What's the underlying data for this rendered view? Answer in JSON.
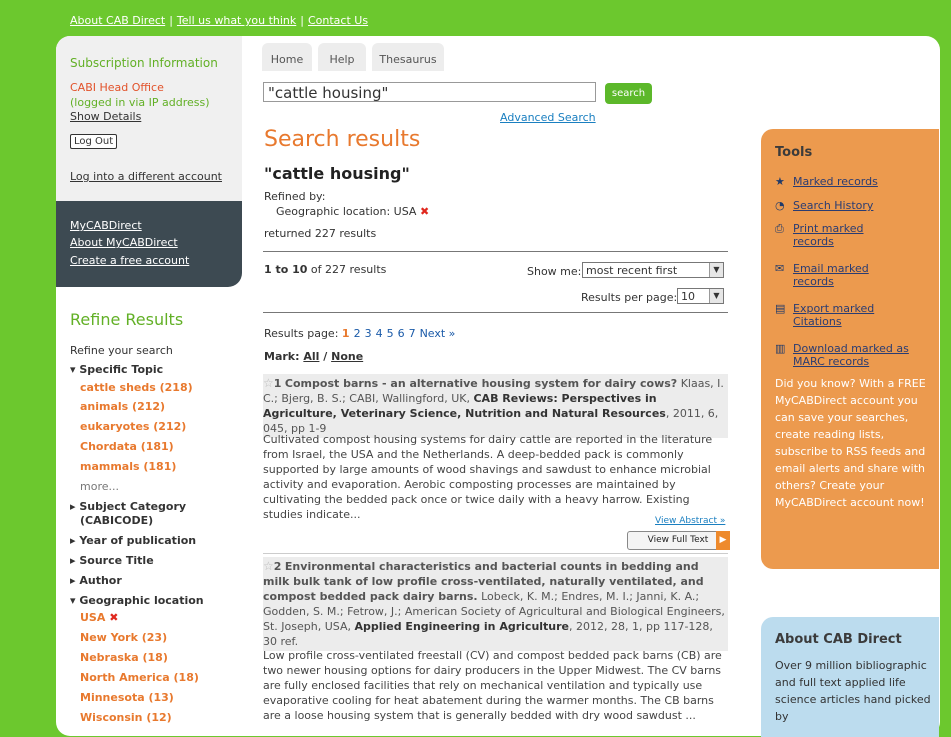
{
  "top_links": [
    "About CAB Direct",
    "Tell us what you think",
    "Contact Us"
  ],
  "subscription": {
    "title": "Subscription Information",
    "org": "CABI Head Office",
    "ip_note": "(logged in via IP address)",
    "show_details": "Show Details",
    "logout": "Log Out",
    "different_account": "Log into a different account"
  },
  "my_links": [
    "MyCABDirect",
    "About MyCABDirect",
    "Create a free account"
  ],
  "refine": {
    "title": "Refine Results",
    "subtitle": "Refine your search",
    "facets": {
      "specific_topic": {
        "label": "▾ Specific Topic",
        "items": [
          "cattle sheds (218)",
          "animals (212)",
          "eukaryotes (212)",
          "Chordata (181)",
          "mammals (181)"
        ],
        "more": "more..."
      },
      "subject_category": {
        "label": "▸ Subject Category",
        "label2": "(CABICODE)"
      },
      "year": {
        "label": "▸ Year of publication"
      },
      "source": {
        "label": "▸ Source Title"
      },
      "author": {
        "label": "▸ Author"
      },
      "geo": {
        "label": "▾ Geographic location",
        "selected": "USA",
        "items": [
          "New York (23)",
          "Nebraska (18)",
          "North America (18)",
          "Minnesota (13)",
          "Wisconsin (12)"
        ]
      }
    }
  },
  "tabs": [
    "Home",
    "Help",
    "Thesaurus"
  ],
  "search": {
    "value": "\"cattle housing\"",
    "button": "search",
    "advanced": "Advanced Search"
  },
  "results": {
    "title": "Search results",
    "query": "\"cattle housing\"",
    "refined_by": "Refined by:",
    "refined_value": "Geographic location: USA",
    "returned": "returned 227 results",
    "range_bold": "1 to 10",
    "range_rest": " of 227 results",
    "show_me_label": "Show me:",
    "show_me_value": "most recent first",
    "rpp_label": "Results per page:",
    "rpp_value": "10",
    "pages_label": "Results page:",
    "current_page": "1",
    "pages": [
      "2",
      "3",
      "4",
      "5",
      "6",
      "7",
      "Next »"
    ],
    "mark_label": "Mark:",
    "mark_all": "All",
    "mark_sep": " / ",
    "mark_none": "None",
    "view_abstract": "View Abstract »",
    "view_full_text": "View Full Text",
    "records": [
      {
        "num": "1",
        "title": "Compost barns - an alternative housing system for dairy cows?",
        "authors": "Klaas, I. C.; Bjerg, B. S.; CABI, Wallingford, UK,",
        "journal": "CAB Reviews: Perspectives in Agriculture, Veterinary Science, Nutrition and Natural Resources",
        "citation": ", 2011, 6, 045, pp 1-9",
        "abstract": "Cultivated compost housing systems for dairy cattle are reported in the literature from Israel, the USA and the Netherlands. A deep-bedded pack is commonly supported by large amounts of wood shavings and sawdust to enhance microbial activity and evaporation. Aerobic composting processes are maintained by cultivating the bedded pack once or twice daily with a heavy harrow. Existing studies indicate..."
      },
      {
        "num": "2",
        "title": "Environmental characteristics and bacterial counts in bedding and milk bulk tank of low profile cross-ventilated, naturally ventilated, and compost bedded pack dairy barns.",
        "authors": "Lobeck, K. M.; Endres, M. I.; Janni, K. A.; Godden, S. M.; Fetrow, J.; American Society of Agricultural and Biological Engineers, St. Joseph, USA,",
        "journal": "Applied Engineering in Agriculture",
        "citation": ", 2012, 28, 1, pp 117-128, 30 ref.",
        "abstract": "Low profile cross-ventilated freestall (CV) and compost bedded pack barns (CB) are two newer housing options for dairy producers in the Upper Midwest. The CV barns are fully enclosed facilities that rely on mechanical ventilation and typically use evaporative cooling for heat abatement during the warmer months. The CB barns are a loose housing system that is generally bedded with dry wood sawdust ..."
      }
    ]
  },
  "tools": {
    "title": "Tools",
    "items": [
      {
        "icon": "star-icon",
        "label": "Marked records"
      },
      {
        "icon": "history-icon",
        "label": "Search History"
      },
      {
        "icon": "printer-icon",
        "label": "Print marked records"
      },
      {
        "icon": "email-icon",
        "label": "Email marked records"
      },
      {
        "icon": "export-icon",
        "label": "Export marked Citations"
      },
      {
        "icon": "download-icon",
        "label": "Download marked as MARC records"
      }
    ],
    "did_you_know": "Did you know? With a FREE MyCABDirect account you can save your searches, create reading lists, subscribe to RSS feeds and email alerts and share with others? Create your MyCABDirect account now!"
  },
  "about": {
    "title": "About CAB Direct",
    "text": "Over 9 million bibliographic and full text applied life science articles hand picked by"
  },
  "colors": {
    "background": "#6cc82e",
    "orange": "#e8792e",
    "tools_bg": "#ec9a4e",
    "about_bg": "#bcdcee",
    "dark_box": "#3d4a52"
  }
}
